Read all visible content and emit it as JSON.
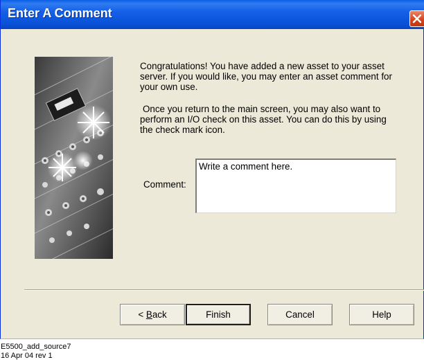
{
  "window": {
    "title": "Enter A Comment",
    "close_icon": "close-x-icon"
  },
  "content": {
    "paragraph1": "Congratulations!  You have added a new asset to your asset server.  If you would like, you may enter an asset comment for your own use.",
    "paragraph2": "Once you return to the main screen, you may also want to perform an I/O check on this asset.  You can do this by using the check mark icon.",
    "comment_label": "Comment:",
    "comment_value": "Write a comment here.",
    "artwork_icon": "equipment-photo-icon"
  },
  "buttons": {
    "back_prefix": "< ",
    "back_mnemonic": "B",
    "back_rest": "ack",
    "finish": "Finish",
    "cancel": "Cancel",
    "help": "Help"
  },
  "caption": {
    "line1": "E5500_add_source7",
    "line2": "16 Apr 04  rev 1"
  },
  "colors": {
    "titlebar": "#0a53d8",
    "dialog_background": "#ece9d8",
    "close_button": "#d3421c"
  }
}
